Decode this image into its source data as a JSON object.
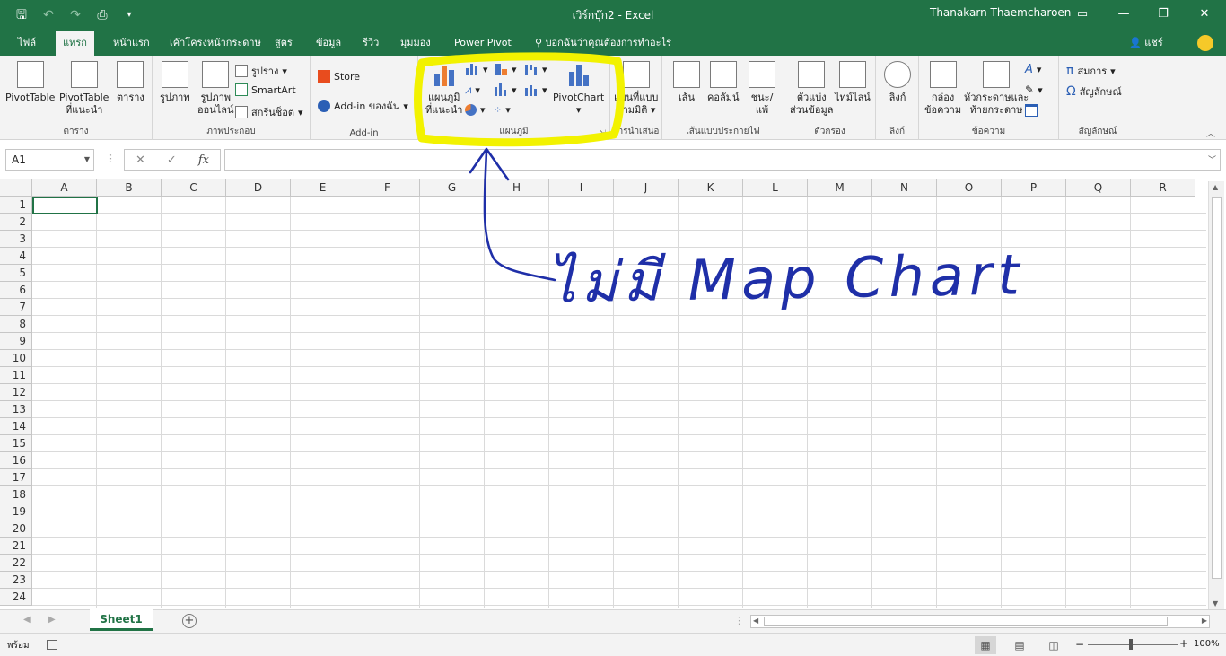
{
  "app": {
    "title": "เวิร์กบุ๊ก2  -  Excel",
    "user": "Thanakarn Thaemcharoen",
    "share_label": "แชร์",
    "tell_me": "บอกฉันว่าคุณต้องการทำอะไร"
  },
  "tabs": [
    "ไฟล์",
    "แทรก",
    "หน้าแรก",
    "เค้าโครงหน้ากระดาษ",
    "สูตร",
    "ข้อมูล",
    "รีวิว",
    "มุมมอง",
    "Power Pivot"
  ],
  "ribbon": {
    "tables": {
      "label": "ตาราง",
      "pivottable": "PivotTable",
      "recommended_pivot_l1": "PivotTable",
      "recommended_pivot_l2": "ที่แนะนำ",
      "table": "ตาราง"
    },
    "illustrations": {
      "label": "ภาพประกอบ",
      "pictures": "รูปภาพ",
      "online_pictures_l1": "รูปภาพ",
      "online_pictures_l2": "ออนไลน์",
      "shapes": "รูปร่าง",
      "smartart": "SmartArt",
      "screenshot": "สกรีนช็อต"
    },
    "addins": {
      "label": "Add-in",
      "store": "Store",
      "my_addins": "Add-in ของฉัน"
    },
    "charts": {
      "label": "แผนภูมิ",
      "recommended_l1": "แผนภูมิ",
      "recommended_l2": "ที่แนะนำ",
      "pivotchart": "PivotChart"
    },
    "tours": {
      "label": "การนำเสนอ",
      "map3d_l1": "แผนที่แบบ",
      "map3d_l2": "สามมิติ"
    },
    "sparklines": {
      "label": "เส้นแบบประกายไฟ",
      "line": "เส้น",
      "column": "คอลัมน์",
      "winloss_l1": "ชนะ/",
      "winloss_l2": "แพ้"
    },
    "filters": {
      "label": "ตัวกรอง",
      "slicer_l1": "ตัวแบ่ง",
      "slicer_l2": "ส่วนข้อมูล",
      "timeline": "ไทม์ไลน์"
    },
    "links": {
      "label": "ลิงก์",
      "link": "ลิงก์"
    },
    "text": {
      "label": "ข้อความ",
      "textbox_l1": "กล่อง",
      "textbox_l2": "ข้อความ",
      "header_l1": "หัวกระดาษและ",
      "header_l2": "ท้ายกระดาษ"
    },
    "symbols": {
      "label": "สัญลักษณ์",
      "equation": "สมการ",
      "symbol": "สัญลักษณ์"
    }
  },
  "formula_bar": {
    "name_box": "A1",
    "fx": "fx",
    "cancel": "✕",
    "enter": "✓"
  },
  "grid": {
    "columns": [
      "A",
      "B",
      "C",
      "D",
      "E",
      "F",
      "G",
      "H",
      "I",
      "J",
      "K",
      "L",
      "M",
      "N",
      "O",
      "P",
      "Q",
      "R"
    ],
    "rows": [
      "1",
      "2",
      "3",
      "4",
      "5",
      "6",
      "7",
      "8",
      "9",
      "10",
      "11",
      "12",
      "13",
      "14",
      "15",
      "16",
      "17",
      "18",
      "19",
      "20",
      "21",
      "22",
      "23",
      "24"
    ]
  },
  "sheets": {
    "active": "Sheet1"
  },
  "status": {
    "ready": "พร้อม",
    "zoom": "100%"
  },
  "annotation": {
    "text": "ไม่มี Map Chart",
    "color": "#1f2fa8",
    "highlight_color": "#f2f200"
  }
}
